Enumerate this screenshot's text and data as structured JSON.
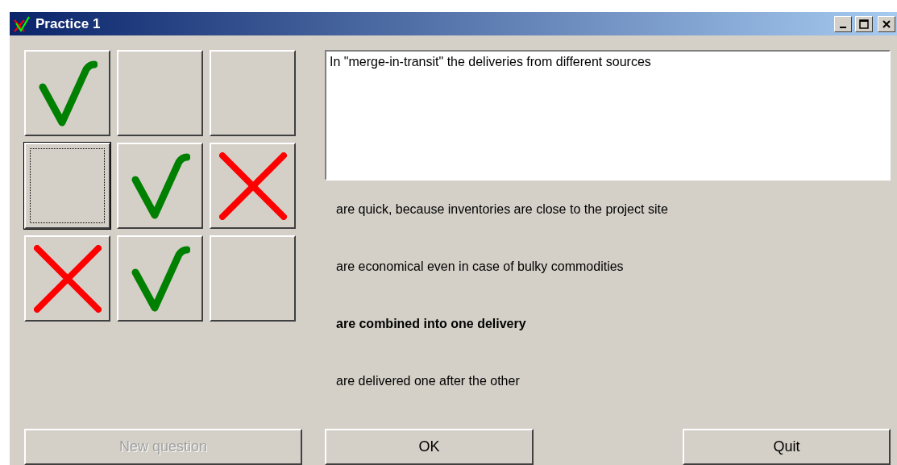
{
  "window": {
    "title": "Practice 1"
  },
  "grid": [
    {
      "kind": "check",
      "focused": false
    },
    {
      "kind": "empty",
      "focused": false
    },
    {
      "kind": "empty",
      "focused": false
    },
    {
      "kind": "empty",
      "focused": true
    },
    {
      "kind": "check",
      "focused": false
    },
    {
      "kind": "cross",
      "focused": false
    },
    {
      "kind": "cross",
      "focused": false
    },
    {
      "kind": "check",
      "focused": false
    },
    {
      "kind": "empty",
      "focused": false
    }
  ],
  "question": "In \"merge-in-transit\" the deliveries from different sources",
  "answers": [
    {
      "text": "are quick, because inventories are close to the project site",
      "selected": false
    },
    {
      "text": "are economical even in case of bulky commodities",
      "selected": false
    },
    {
      "text": "are combined into one delivery",
      "selected": true
    },
    {
      "text": "are delivered one after the other",
      "selected": false
    }
  ],
  "buttons": [
    {
      "kind": "new",
      "label": "New question",
      "disabled": true
    },
    {
      "kind": "ok",
      "label": "OK",
      "disabled": false
    },
    {
      "kind": "quit",
      "label": "Quit",
      "disabled": false
    }
  ]
}
